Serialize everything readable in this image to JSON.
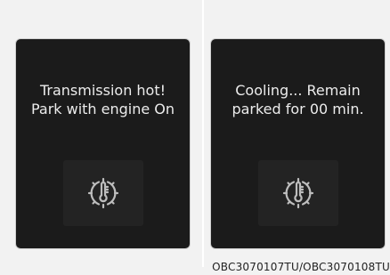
{
  "panels": [
    {
      "line1": "Transmission hot!",
      "line2": "Park with engine On",
      "icon": "transmission-temperature-warning-icon"
    },
    {
      "line1": "Cooling... Remain",
      "line2": "parked for 00 min.",
      "icon": "transmission-temperature-warning-icon"
    }
  ],
  "caption": "OBC3070107TU/OBC3070108TU",
  "colors": {
    "panel_bg": "#1b1b1b",
    "text": "#ececec",
    "icon": "#bdbdbd"
  }
}
